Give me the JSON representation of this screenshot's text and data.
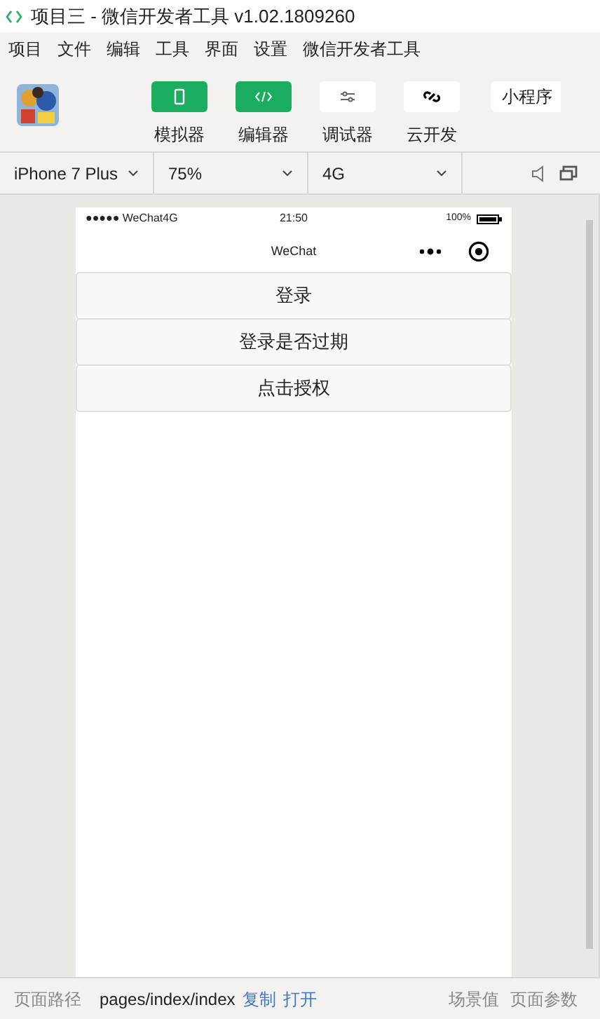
{
  "window": {
    "title": "项目三 - 微信开发者工具 v1.02.1809260"
  },
  "menu": [
    "项目",
    "文件",
    "编辑",
    "工具",
    "界面",
    "设置",
    "微信开发者工具"
  ],
  "toolbar": {
    "buttons": [
      {
        "label": "模拟器",
        "kind": "phone",
        "selected": true
      },
      {
        "label": "编辑器",
        "kind": "code",
        "selected": true
      },
      {
        "label": "调试器",
        "kind": "sliders",
        "selected": false
      },
      {
        "label": "云开发",
        "kind": "link",
        "selected": false
      }
    ],
    "mode": "小程序"
  },
  "device_bar": {
    "device": "iPhone 7 Plus",
    "zoom": "75%",
    "network": "4G"
  },
  "phone": {
    "carrier": "●●●●● WeChat4G",
    "time": "21:50",
    "battery": "100%",
    "nav_title": "WeChat",
    "buttons": [
      "登录",
      "登录是否过期",
      "点击授权"
    ]
  },
  "status_bar": {
    "label": "页面路径",
    "path": "pages/index/index",
    "actions": [
      "复制",
      "打开"
    ],
    "right": [
      "场景值",
      "页面参数"
    ]
  }
}
